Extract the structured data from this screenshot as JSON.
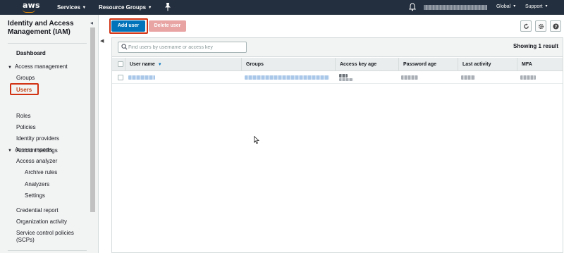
{
  "topnav": {
    "logo_text": "aws",
    "services_label": "Services",
    "resource_groups_label": "Resource Groups",
    "region_label": "Global",
    "support_label": "Support",
    "caret_glyph": "▾",
    "colors": {
      "background": "#232f3e",
      "logo_smile": "#ff9900"
    }
  },
  "sidebar": {
    "title": "Identity and Access Management (IAM)",
    "collapse_glyph": "◂",
    "dashboard_label": "Dashboard",
    "sections": [
      {
        "label": "Access management",
        "expanded": true,
        "items": [
          "Groups",
          "Users",
          "Roles",
          "Policies",
          "Identity providers",
          "Account settings"
        ]
      },
      {
        "label": "Access reports",
        "expanded": true,
        "items": [
          "Access analyzer",
          "Archive rules",
          "Analyzers",
          "Settings",
          "Credential report",
          "Organization activity",
          "Service control policies (SCPs)"
        ]
      }
    ],
    "active_item": "Users",
    "colors": {
      "active_text": "#c1471c",
      "highlight_border": "#d13212"
    }
  },
  "toolbar": {
    "add_user_label": "Add user",
    "delete_user_label": "Delete user",
    "icons": [
      "refresh-icon",
      "gear-icon",
      "help-icon"
    ],
    "colors": {
      "primary": "#0073bb",
      "disabled_danger": "#e8a3a3"
    }
  },
  "table": {
    "search_placeholder": "Find users by username or access key",
    "results_text": "Showing 1 result",
    "columns": [
      "User name",
      "Groups",
      "Access key age",
      "Password age",
      "Last activity",
      "MFA"
    ],
    "sorted_column": "User name",
    "sort_direction": "descending"
  }
}
